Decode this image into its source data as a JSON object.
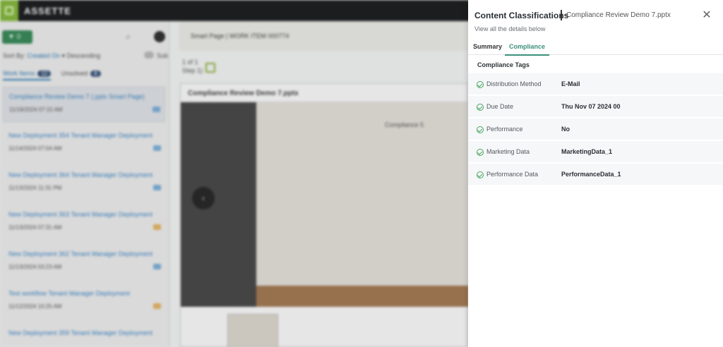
{
  "app": {
    "brand": "ASSETTE",
    "filter_label": "0",
    "sort_label": "Sort By: ",
    "sort_field": "Created On",
    "sort_order": "Descending",
    "sub_label": "Sub",
    "tabs": [
      {
        "label": "Work Items",
        "count": "12"
      },
      {
        "label": "Unsolved",
        "count": "8"
      }
    ],
    "list": [
      {
        "title": "Compliance Review Demo 7 (.pptx Smart Page)",
        "date": "11/19/2024 07:15 AM"
      },
      {
        "title": "New Deployment 354 Tenant Manager Deployment",
        "date": "11/14/2024 07:04 AM"
      },
      {
        "title": "New Deployment 364 Tenant Manager Deployment",
        "date": "11/13/2024 11:31 PM"
      },
      {
        "title": "New Deployment 363 Tenant Manager Deployment",
        "date": "11/13/2024 07:31 AM"
      },
      {
        "title": "New Deployment 362 Tenant Manager Deployment",
        "date": "11/13/2024 03:23 AM"
      },
      {
        "title": "Test workflow Tenant Manager Deployment",
        "date": "11/12/2024 10:25 AM"
      },
      {
        "title": "New Deployment 359 Tenant Manager Deployment",
        "date": ""
      }
    ],
    "crumb": "Smart Page | WORK ITEM 000774",
    "pager_line1": "1 of 1",
    "pager_line2": "Step 1)",
    "doc_title": "Compliance Review Demo 7.pptx",
    "slide_text": "Compliance 5"
  },
  "drawer": {
    "title": "Content Classifications",
    "file": "Compliance Review Demo 7.pptx",
    "subtitle": "View all the details below",
    "close": "✕",
    "tabs": [
      {
        "label": "Summary"
      },
      {
        "label": "Compliance"
      }
    ],
    "section_title": "Compliance Tags",
    "tags": [
      {
        "label": "Distribution Method",
        "value": "E-Mail"
      },
      {
        "label": "Due Date",
        "value": "Thu Nov 07 2024 00"
      },
      {
        "label": "Performance",
        "value": "No"
      },
      {
        "label": "Marketing Data",
        "value": "MarketingData_1"
      },
      {
        "label": "Performance Data",
        "value": "PerformanceData_1"
      }
    ]
  },
  "colors": {
    "accent": "#3b8f7a",
    "check": "#46a35f",
    "topbar": "#1b1d1f",
    "brand_green": "#7aa83a"
  }
}
